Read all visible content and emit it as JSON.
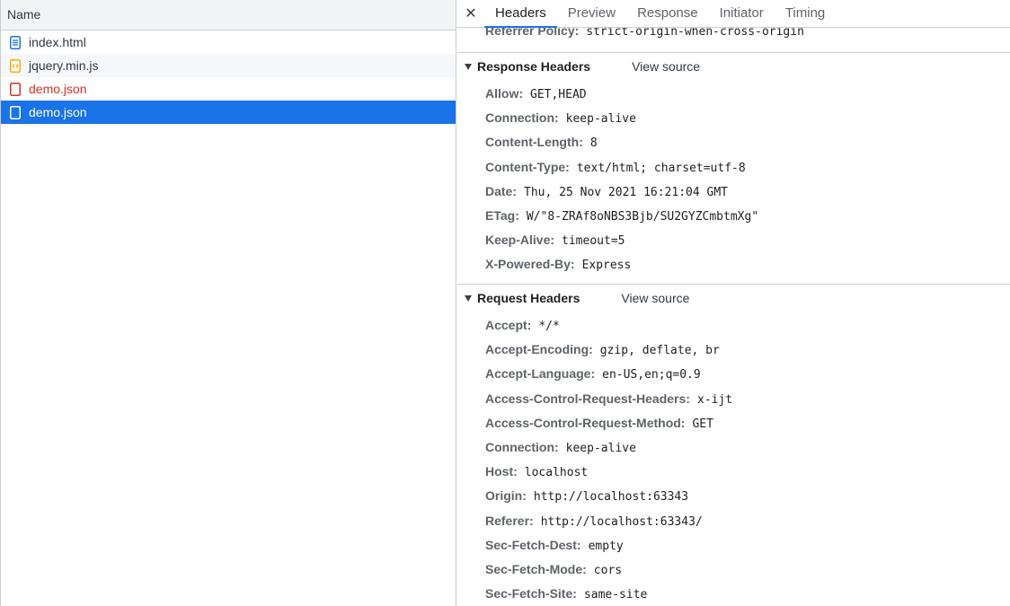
{
  "left": {
    "column_header": "Name",
    "requests": [
      {
        "name": "index.html",
        "icon": "document-icon",
        "icon_color": "#1a73e8"
      },
      {
        "name": "jquery.min.js",
        "icon": "script-icon",
        "icon_color": "#f9ab00"
      },
      {
        "name": "demo.json",
        "icon": "document-outline-icon",
        "icon_color": "#d93025",
        "status": "error"
      },
      {
        "name": "demo.json",
        "icon": "document-outline-icon",
        "icon_color": "#ffffff",
        "status": "selected"
      }
    ]
  },
  "tabs": {
    "close_symbol": "✕",
    "items": [
      "Headers",
      "Preview",
      "Response",
      "Initiator",
      "Timing"
    ],
    "active": "Headers"
  },
  "general": {
    "referrer_policy": {
      "key": "Referrer Policy:",
      "value": "strict-origin-when-cross-origin"
    }
  },
  "response_headers": {
    "title": "Response Headers",
    "view_source": "View source",
    "rows": [
      {
        "key": "Allow:",
        "value": "GET,HEAD"
      },
      {
        "key": "Connection:",
        "value": "keep-alive"
      },
      {
        "key": "Content-Length:",
        "value": "8"
      },
      {
        "key": "Content-Type:",
        "value": "text/html; charset=utf-8"
      },
      {
        "key": "Date:",
        "value": "Thu, 25 Nov 2021 16:21:04 GMT"
      },
      {
        "key": "ETag:",
        "value": "W/\"8-ZRAf8oNBS3Bjb/SU2GYZCmbtmXg\""
      },
      {
        "key": "Keep-Alive:",
        "value": "timeout=5"
      },
      {
        "key": "X-Powered-By:",
        "value": "Express"
      }
    ]
  },
  "request_headers": {
    "title": "Request Headers",
    "view_source": "View source",
    "rows": [
      {
        "key": "Accept:",
        "value": "*/*"
      },
      {
        "key": "Accept-Encoding:",
        "value": "gzip, deflate, br"
      },
      {
        "key": "Accept-Language:",
        "value": "en-US,en;q=0.9"
      },
      {
        "key": "Access-Control-Request-Headers:",
        "value": "x-ijt"
      },
      {
        "key": "Access-Control-Request-Method:",
        "value": "GET"
      },
      {
        "key": "Connection:",
        "value": "keep-alive"
      },
      {
        "key": "Host:",
        "value": "localhost"
      },
      {
        "key": "Origin:",
        "value": "http://localhost:63343"
      },
      {
        "key": "Referer:",
        "value": "http://localhost:63343/"
      },
      {
        "key": "Sec-Fetch-Dest:",
        "value": "empty"
      },
      {
        "key": "Sec-Fetch-Mode:",
        "value": "cors"
      },
      {
        "key": "Sec-Fetch-Site:",
        "value": "same-site"
      }
    ]
  }
}
